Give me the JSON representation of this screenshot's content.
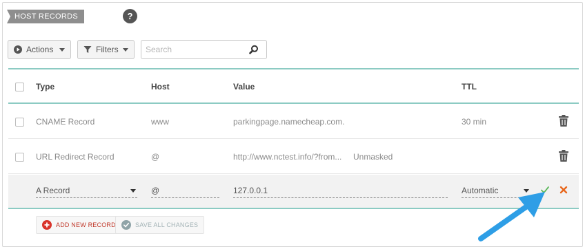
{
  "section": {
    "title": "HOST RECORDS",
    "help_icon": "question-icon"
  },
  "toolbar": {
    "actions_label": "Actions",
    "actions_icon": "play-circle-icon",
    "filters_label": "Filters",
    "filters_icon": "funnel-icon",
    "search_placeholder": "Search",
    "search_icon": "magnifier-icon"
  },
  "table": {
    "columns": [
      "Type",
      "Host",
      "Value",
      "TTL"
    ],
    "rows": [
      {
        "type": "CNAME Record",
        "host": "www",
        "value": "parkingpage.namecheap.com.",
        "extra": "",
        "ttl": "30 min",
        "action_icon": "trash-icon"
      },
      {
        "type": "URL Redirect Record",
        "host": "@",
        "value": "http://www.nctest.info/?from...",
        "extra": "Unmasked",
        "ttl": "",
        "action_icon": "trash-icon"
      }
    ],
    "edit_row": {
      "type": "A Record",
      "host": "@",
      "value": "127.0.0.1",
      "ttl": "Automatic",
      "confirm_icon": "checkmark-icon",
      "cancel_icon": "x-icon"
    }
  },
  "footer": {
    "add_label": "ADD NEW RECORD",
    "add_icon": "plus-circle-icon",
    "save_label": "SAVE ALL CHANGES",
    "save_icon": "check-circle-icon"
  },
  "annotation": {
    "arrow_icon": "pointer-arrow-icon"
  },
  "colors": {
    "teal_rule": "#8ccbc3",
    "accent_red": "#c0392b",
    "confirm_green": "#5cb85c",
    "cancel_orange": "#e8661b",
    "arrow_blue": "#2e9ee6"
  }
}
